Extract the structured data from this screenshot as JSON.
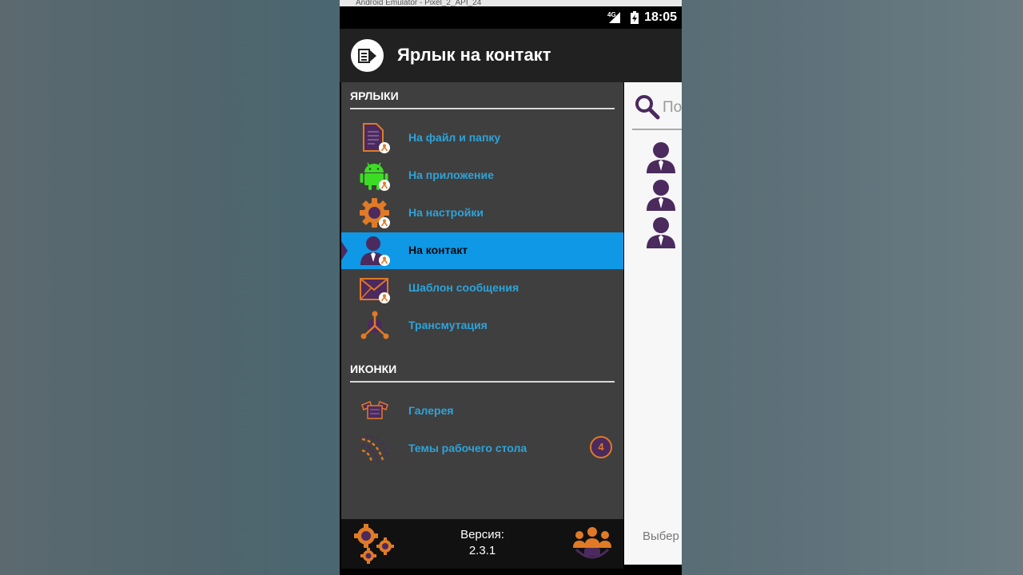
{
  "emulator": {
    "title": "Android Emulator - Pixel_2_API_24"
  },
  "status_bar": {
    "network": "4G",
    "time": "18:05"
  },
  "app_bar": {
    "title": "Ярлык на контакт",
    "logo_icon": "shortcut-logo-icon"
  },
  "drawer": {
    "sections": [
      {
        "header": "ЯРЛЫКИ",
        "items": [
          {
            "label": "На файл и папку",
            "icon": "file-contact-icon",
            "selected": false
          },
          {
            "label": "На приложение",
            "icon": "android-contact-icon",
            "selected": false
          },
          {
            "label": "На настройки",
            "icon": "gear-contact-icon",
            "selected": false
          },
          {
            "label": "На контакт",
            "icon": "person-contact-icon",
            "selected": true
          },
          {
            "label": "Шаблон сообщения",
            "icon": "envelope-contact-icon",
            "selected": false
          },
          {
            "label": "Трансмутация",
            "icon": "transmutation-icon",
            "selected": false
          }
        ]
      },
      {
        "header": "ИКОНКИ",
        "items": [
          {
            "label": "Галерея",
            "icon": "gallery-icon",
            "selected": false
          },
          {
            "label": "Темы рабочего стола",
            "icon": "desktop-themes-icon",
            "selected": false,
            "badge": "4"
          }
        ]
      }
    ],
    "footer": {
      "version_title": "Версия:",
      "version_number": "2.3.1",
      "left_icon": "gears-icon",
      "right_icon": "community-icon"
    }
  },
  "content": {
    "search_placeholder": "По",
    "contacts_count": 3,
    "bottom_hint": "Выбер"
  },
  "colors": {
    "accent": "#0f98e6",
    "label_blue": "#2ea3d9",
    "orange": "#e07a26",
    "purple": "#4b2a5e",
    "android_green": "#3ddc24"
  }
}
